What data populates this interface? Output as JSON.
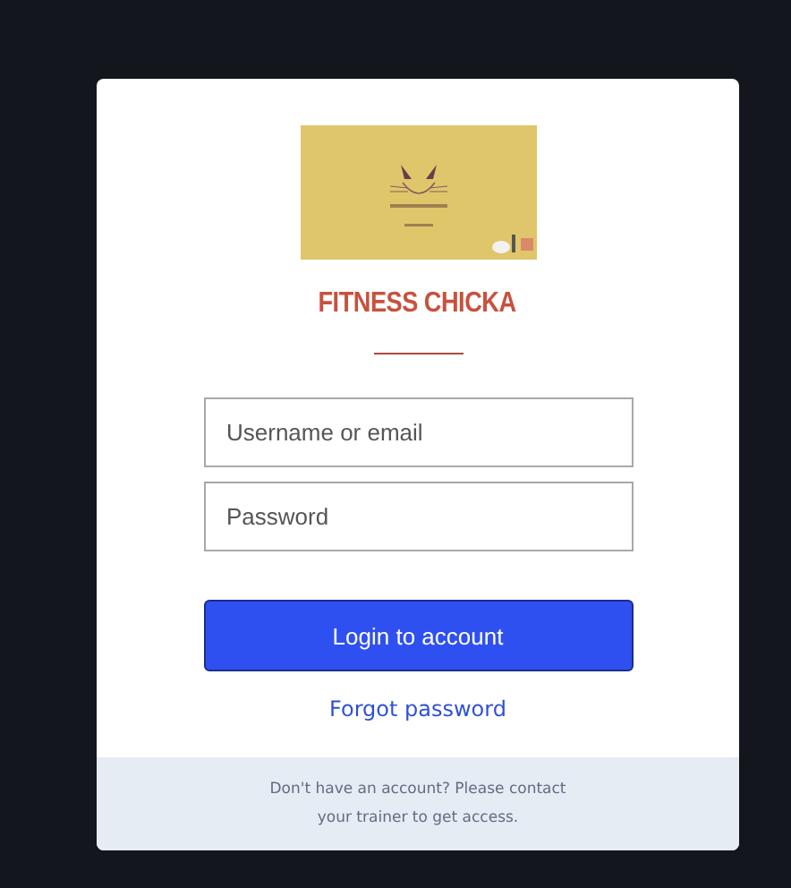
{
  "title": "FITNESS CHICKA",
  "fields": [
    {
      "placeholder": "Username or email"
    },
    {
      "placeholder": "Password"
    }
  ],
  "login_button": "Login to account",
  "forgot_link": "Forgot password",
  "footer": "Don't have an account? Please contact your trainer to get access."
}
